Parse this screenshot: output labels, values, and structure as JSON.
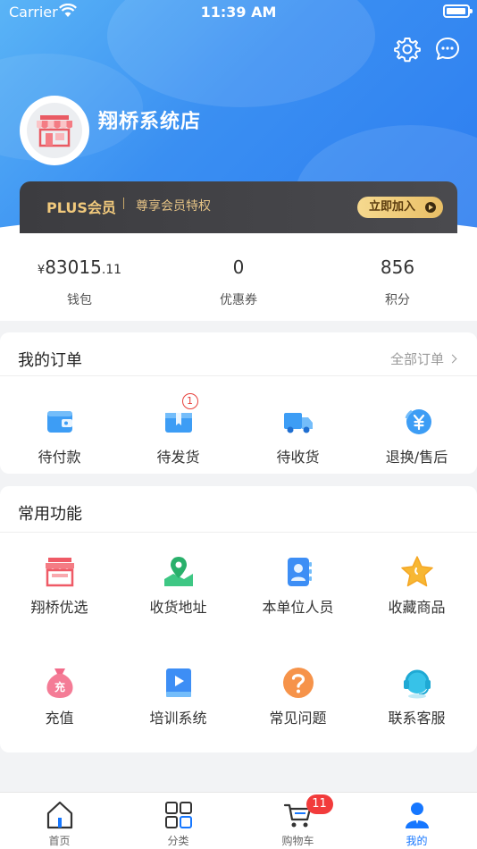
{
  "status_bar": {
    "carrier": "Carrier",
    "time": "11:39 AM"
  },
  "header": {
    "store_name": "翔桥系统店",
    "plus": {
      "title": "PLUS会员",
      "subtitle": "尊享会员特权",
      "button": "立即加入"
    }
  },
  "stats": [
    {
      "currency": "¥",
      "value": "83015",
      "decimal": ".11",
      "label": "钱包"
    },
    {
      "value": "0",
      "label": "优惠券"
    },
    {
      "value": "856",
      "label": "积分"
    }
  ],
  "orders": {
    "title": "我的订单",
    "more": "全部订单",
    "items": [
      {
        "label": "待付款",
        "icon": "wallet-icon"
      },
      {
        "label": "待发货",
        "icon": "package-icon",
        "badge": "1"
      },
      {
        "label": "待收货",
        "icon": "truck-icon"
      },
      {
        "label": "退换/售后",
        "icon": "refund-icon"
      }
    ]
  },
  "functions": {
    "title": "常用功能",
    "items": [
      {
        "label": "翔桥优选",
        "icon": "shop-icon"
      },
      {
        "label": "收货地址",
        "icon": "map-pin-icon"
      },
      {
        "label": "本单位人员",
        "icon": "contacts-icon"
      },
      {
        "label": "收藏商品",
        "icon": "star-icon"
      },
      {
        "label": "充值",
        "icon": "money-bag-icon"
      },
      {
        "label": "培训系统",
        "icon": "video-book-icon"
      },
      {
        "label": "常见问题",
        "icon": "question-icon"
      },
      {
        "label": "联系客服",
        "icon": "headset-icon"
      }
    ]
  },
  "tabbar": {
    "items": [
      {
        "label": "首页"
      },
      {
        "label": "分类"
      },
      {
        "label": "购物车",
        "badge": "11"
      },
      {
        "label": "我的"
      }
    ]
  },
  "colors": {
    "primary": "#1677ff",
    "header": "#3a8ff2",
    "badge": "#f23b3b",
    "gold": "#f1c97c"
  }
}
